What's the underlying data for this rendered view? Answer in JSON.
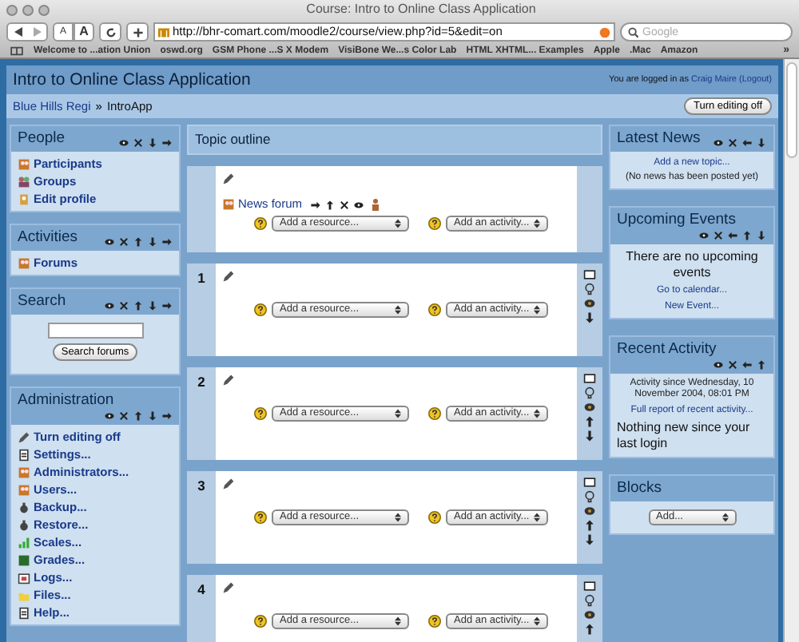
{
  "browser": {
    "title": "Course: Intro to Online Class Application",
    "font_buttons": [
      "A",
      "A"
    ],
    "url": "http://bhr-comart.com/moodle2/course/view.php?id=5&edit=on",
    "search_placeholder": "Google",
    "bookmarks": [
      "Welcome to ...ation Union",
      "oswd.org",
      "GSM Phone ...S X Modem",
      "VisiBone We...s Color Lab",
      "HTML XHTML... Examples",
      "Apple",
      ".Mac",
      "Amazon"
    ],
    "more": "»"
  },
  "header": {
    "course_title": "Intro to Online Class Application",
    "login_prefix": "You are logged in as",
    "login_user": "Craig Maire",
    "logout": "(Logout)",
    "breadcrumb_home": "Blue Hills Regi",
    "breadcrumb_sep": "»",
    "breadcrumb_current": "IntroApp",
    "edit_button": "Turn editing off"
  },
  "left_blocks": [
    {
      "title": "People",
      "kind": "links",
      "controls": [
        {
          "kind": "hide"
        },
        {
          "kind": "delete"
        },
        {
          "kind": "down"
        },
        {
          "kind": "right"
        }
      ],
      "items": [
        {
          "kind": "users",
          "label": "Participants"
        },
        {
          "kind": "group",
          "label": "Groups"
        },
        {
          "kind": "profile",
          "label": "Edit profile"
        }
      ]
    },
    {
      "title": "Activities",
      "kind": "links",
      "controls": [
        {
          "kind": "hide"
        },
        {
          "kind": "delete"
        },
        {
          "kind": "up"
        },
        {
          "kind": "down"
        },
        {
          "kind": "right"
        }
      ],
      "items": [
        {
          "kind": "users",
          "label": "Forums"
        }
      ]
    },
    {
      "title": "Search",
      "kind": "search",
      "controls": [
        {
          "kind": "hide"
        },
        {
          "kind": "delete"
        },
        {
          "kind": "up"
        },
        {
          "kind": "down"
        },
        {
          "kind": "right"
        }
      ],
      "button": "Search forums"
    },
    {
      "title": "Administration",
      "kind": "links",
      "controls": [
        {
          "kind": "hide"
        },
        {
          "kind": "delete"
        },
        {
          "kind": "up"
        },
        {
          "kind": "down"
        },
        {
          "kind": "right"
        }
      ],
      "items": [
        {
          "kind": "edit",
          "label": "Turn editing off"
        },
        {
          "kind": "doc",
          "label": "Settings..."
        },
        {
          "kind": "users",
          "label": "Administrators..."
        },
        {
          "kind": "users",
          "label": "Users..."
        },
        {
          "kind": "backup",
          "label": "Backup..."
        },
        {
          "kind": "backup",
          "label": "Restore..."
        },
        {
          "kind": "scales",
          "label": "Scales..."
        },
        {
          "kind": "grades",
          "label": "Grades..."
        },
        {
          "kind": "logs",
          "label": "Logs..."
        },
        {
          "kind": "folder",
          "label": "Files..."
        },
        {
          "kind": "doc",
          "label": "Help..."
        }
      ]
    }
  ],
  "topic_outline": {
    "title": "Topic outline",
    "sections": [
      {
        "forum": "News forum",
        "add_resource": "Add a resource...",
        "add_activity": "Add an activity..."
      },
      {
        "number": "1",
        "add_resource": "Add a resource...",
        "add_activity": "Add an activity...",
        "side_icons": [
          {
            "kind": "box"
          },
          {
            "kind": "bulb"
          },
          {
            "kind": "eye"
          },
          {
            "kind": "down"
          }
        ]
      },
      {
        "number": "2",
        "add_resource": "Add a resource...",
        "add_activity": "Add an activity...",
        "side_icons": [
          {
            "kind": "box"
          },
          {
            "kind": "bulb"
          },
          {
            "kind": "eye"
          },
          {
            "kind": "up"
          },
          {
            "kind": "down"
          }
        ]
      },
      {
        "number": "3",
        "add_resource": "Add a resource...",
        "add_activity": "Add an activity...",
        "side_icons": [
          {
            "kind": "box"
          },
          {
            "kind": "bulb"
          },
          {
            "kind": "eye"
          },
          {
            "kind": "up"
          },
          {
            "kind": "down"
          }
        ]
      },
      {
        "number": "4",
        "add_resource": "Add a resource...",
        "add_activity": "Add an activity...",
        "side_icons": [
          {
            "kind": "box"
          },
          {
            "kind": "bulb"
          },
          {
            "kind": "eye"
          },
          {
            "kind": "up"
          }
        ]
      }
    ]
  },
  "right_blocks": [
    {
      "title": "Latest News",
      "controls": [
        {
          "kind": "hide"
        },
        {
          "kind": "delete"
        },
        {
          "kind": "left"
        },
        {
          "kind": "down"
        }
      ],
      "items": [
        {
          "kind": "link",
          "text": "Add a new topic..."
        },
        {
          "kind": "small",
          "text": "(No news has been posted yet)"
        }
      ]
    },
    {
      "title": "Upcoming Events",
      "controls": [
        {
          "kind": "hide"
        },
        {
          "kind": "delete"
        },
        {
          "kind": "left"
        },
        {
          "kind": "up"
        },
        {
          "kind": "down"
        }
      ],
      "items": [
        {
          "kind": "text",
          "text": "There are no upcoming events"
        },
        {
          "kind": "link",
          "text": "Go to calendar..."
        },
        {
          "kind": "link",
          "text": "New Event..."
        }
      ]
    },
    {
      "title": "Recent Activity",
      "controls": [
        {
          "kind": "hide"
        },
        {
          "kind": "delete"
        },
        {
          "kind": "left"
        },
        {
          "kind": "up"
        }
      ],
      "items": [
        {
          "kind": "small",
          "text": "Activity since Wednesday, 10 November 2004, 08:01 PM"
        },
        {
          "kind": "link",
          "text": "Full report of recent activity..."
        },
        {
          "kind": "paragraph",
          "text": "Nothing new since your last login"
        }
      ]
    },
    {
      "title": "Blocks",
      "items": [
        {
          "kind": "select",
          "text": "Add..."
        }
      ]
    }
  ]
}
